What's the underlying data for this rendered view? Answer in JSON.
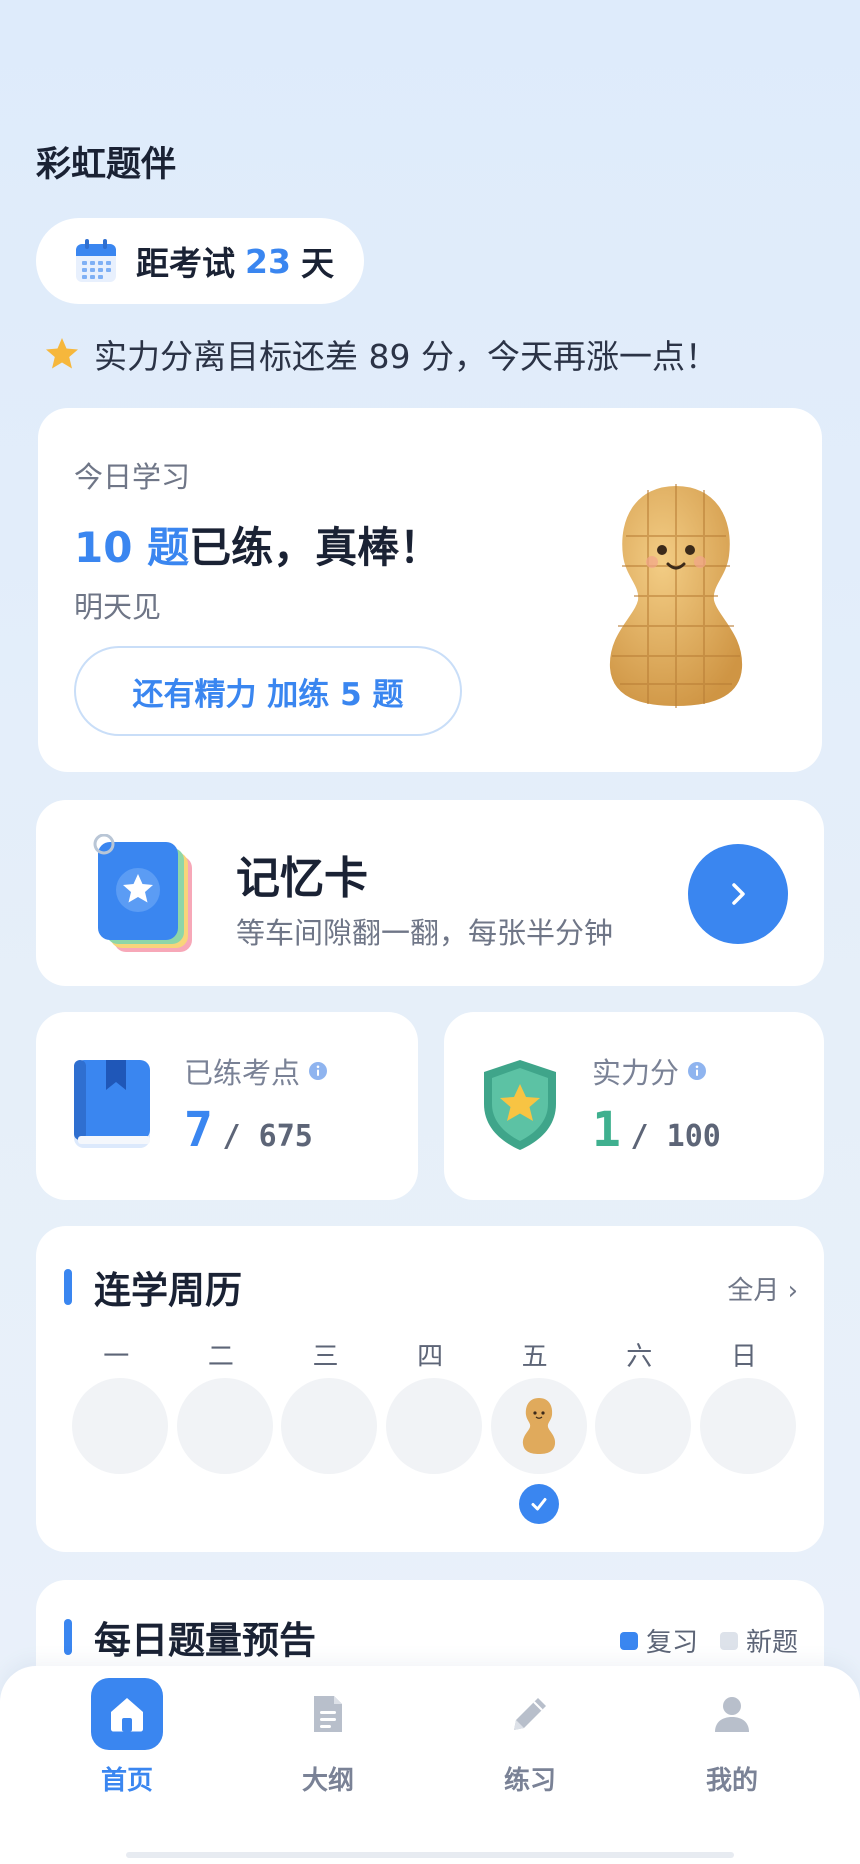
{
  "app": {
    "title": "彩虹题伴"
  },
  "countdown": {
    "prefix": "距考试",
    "days": "23",
    "suffix": "天",
    "icon": "calendar-icon"
  },
  "motto": {
    "text": "实力分离目标还差 89 分，今天再涨一点！",
    "icon": "star-icon"
  },
  "today": {
    "label": "今日学习",
    "count": "10 题",
    "headline_rest": "已练，真棒！",
    "sub": "明天见",
    "extra_button": "还有精力 加练 5 题",
    "mascot": "peanut-mascot"
  },
  "memory_card": {
    "title": "记忆卡",
    "desc": "等车间隙翻一翻，每张半分钟",
    "icon": "flashcard-deck-icon",
    "action": "chevron-right-icon"
  },
  "stats": {
    "points": {
      "label": "已练考点",
      "value": "7",
      "total": "/ 675",
      "icon": "book-icon"
    },
    "strength": {
      "label": "实力分",
      "value": "1",
      "total": "/ 100",
      "icon": "shield-star-icon"
    }
  },
  "calendar": {
    "title": "连学周历",
    "month_link": "全月 ›",
    "weekdays": [
      "一",
      "二",
      "三",
      "四",
      "五",
      "六",
      "日"
    ],
    "checked_day_index": 4
  },
  "forecast": {
    "title": "每日题量预告",
    "legend": {
      "review": "复习",
      "new": "新题"
    }
  },
  "tabs": [
    {
      "label": "首页",
      "icon": "home-icon",
      "active": true
    },
    {
      "label": "大纲",
      "icon": "document-icon",
      "active": false
    },
    {
      "label": "练习",
      "icon": "pencil-icon",
      "active": false
    },
    {
      "label": "我的",
      "icon": "user-icon",
      "active": false
    }
  ],
  "colors": {
    "accent": "#3a86f0",
    "strength_green": "#3fb08f",
    "text_primary": "#1a2234",
    "text_secondary": "#6f7687"
  }
}
